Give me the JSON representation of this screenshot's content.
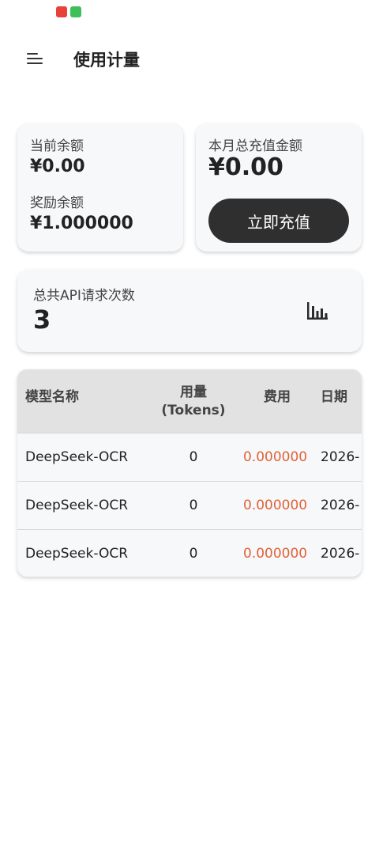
{
  "app_bar": {
    "title": "使用计量",
    "menu_icon": "menu-icon"
  },
  "status_bar": {
    "icons": [
      "huawei-app-icon",
      "green-app-icon"
    ]
  },
  "balance_card": {
    "current_label": "当前余额",
    "current_value": "¥0.00",
    "bonus_label": "奖励余额",
    "bonus_value": "¥1.000000"
  },
  "recharge_card": {
    "month_label": "本月总充值金额",
    "month_value": "¥0.00",
    "button_label": "立即充值"
  },
  "requests_card": {
    "label": "总共API请求次数",
    "value": "3",
    "icon": "bar-chart-icon"
  },
  "usage_table": {
    "headers": {
      "model": "模型名称",
      "usage_line1": "用量",
      "usage_line2": "(Tokens)",
      "cost": "费用",
      "date": "日期"
    },
    "rows": [
      {
        "model": "DeepSeek-OCR",
        "usage": "0",
        "cost": "0.000000",
        "date": "2026-"
      },
      {
        "model": "DeepSeek-OCR",
        "usage": "0",
        "cost": "0.000000",
        "date": "2026-"
      },
      {
        "model": "DeepSeek-OCR",
        "usage": "0",
        "cost": "0.000000",
        "date": "2026-"
      }
    ]
  },
  "colors": {
    "cost_text": "#e0623a",
    "button_bg": "#2f2f2f",
    "card_bg": "#f7f8f9",
    "table_header_bg": "#e2e2e2"
  }
}
